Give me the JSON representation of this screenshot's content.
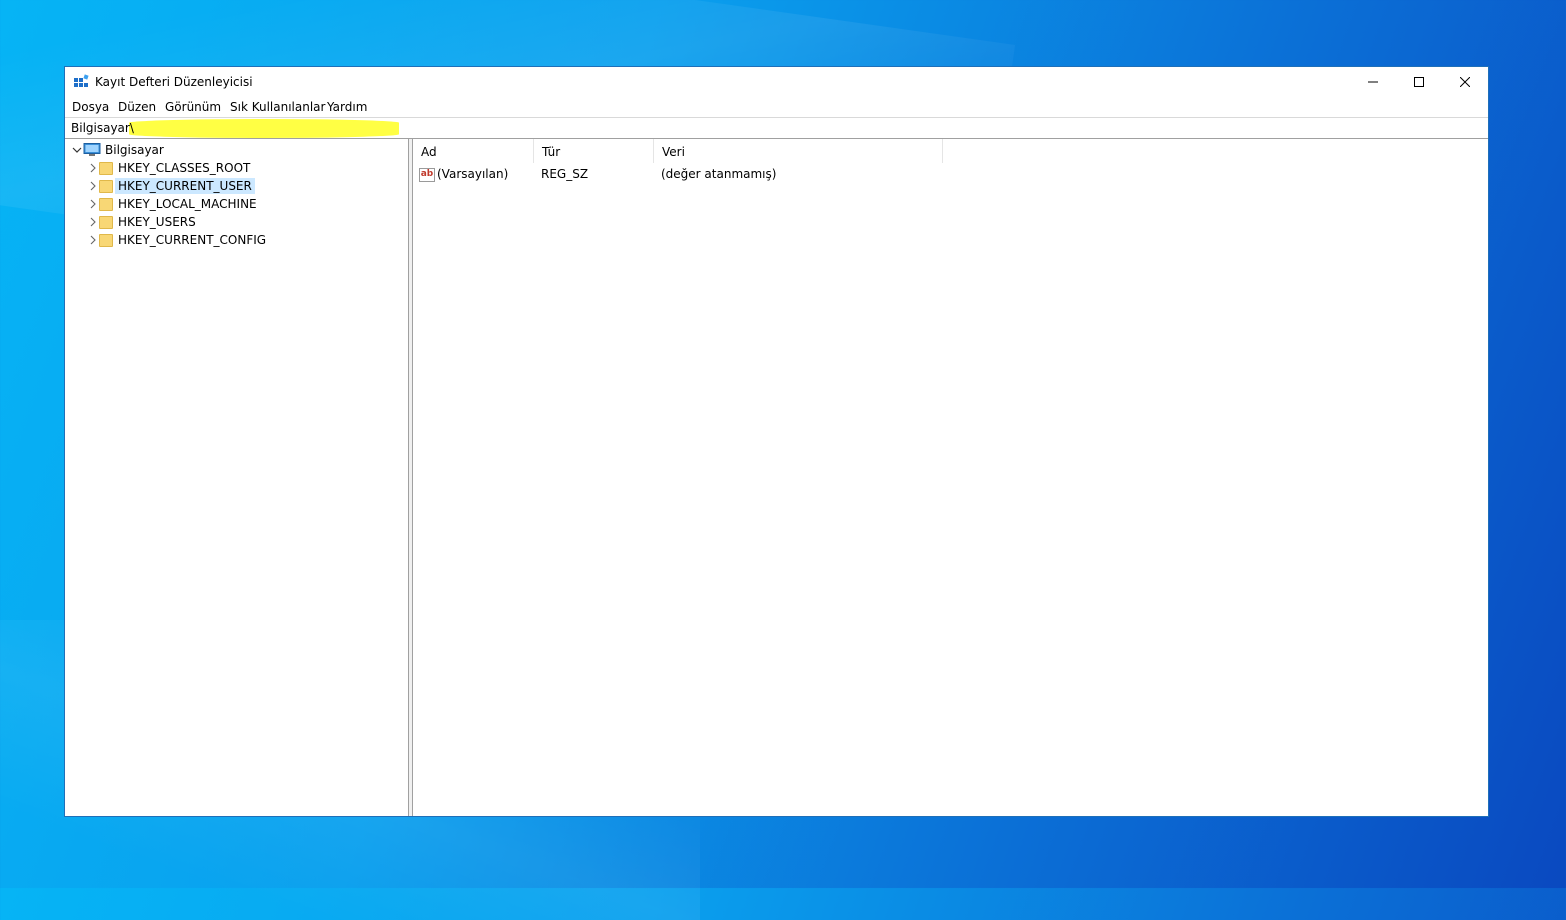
{
  "window": {
    "title": "Kayıt Defteri Düzenleyicisi",
    "icon": "registry-editor-icon"
  },
  "menu": [
    "Dosya",
    "Düzen",
    "Görünüm",
    "Sık Kullanılanlar",
    "Yardım"
  ],
  "address": "Bilgisayar\\",
  "tree": {
    "root": "Bilgisayar",
    "items": [
      "HKEY_CLASSES_ROOT",
      "HKEY_CURRENT_USER",
      "HKEY_LOCAL_MACHINE",
      "HKEY_USERS",
      "HKEY_CURRENT_CONFIG"
    ],
    "selected": "HKEY_CURRENT_USER"
  },
  "list": {
    "columns": [
      "Ad",
      "Tür",
      "Veri"
    ],
    "rows": [
      {
        "name": "(Varsayılan)",
        "type": "REG_SZ",
        "data": "(değer atanmamış)"
      }
    ]
  },
  "colors": {
    "selection": "#cce8ff",
    "highlight": "#ffff3a",
    "folder": "#f8d775"
  }
}
